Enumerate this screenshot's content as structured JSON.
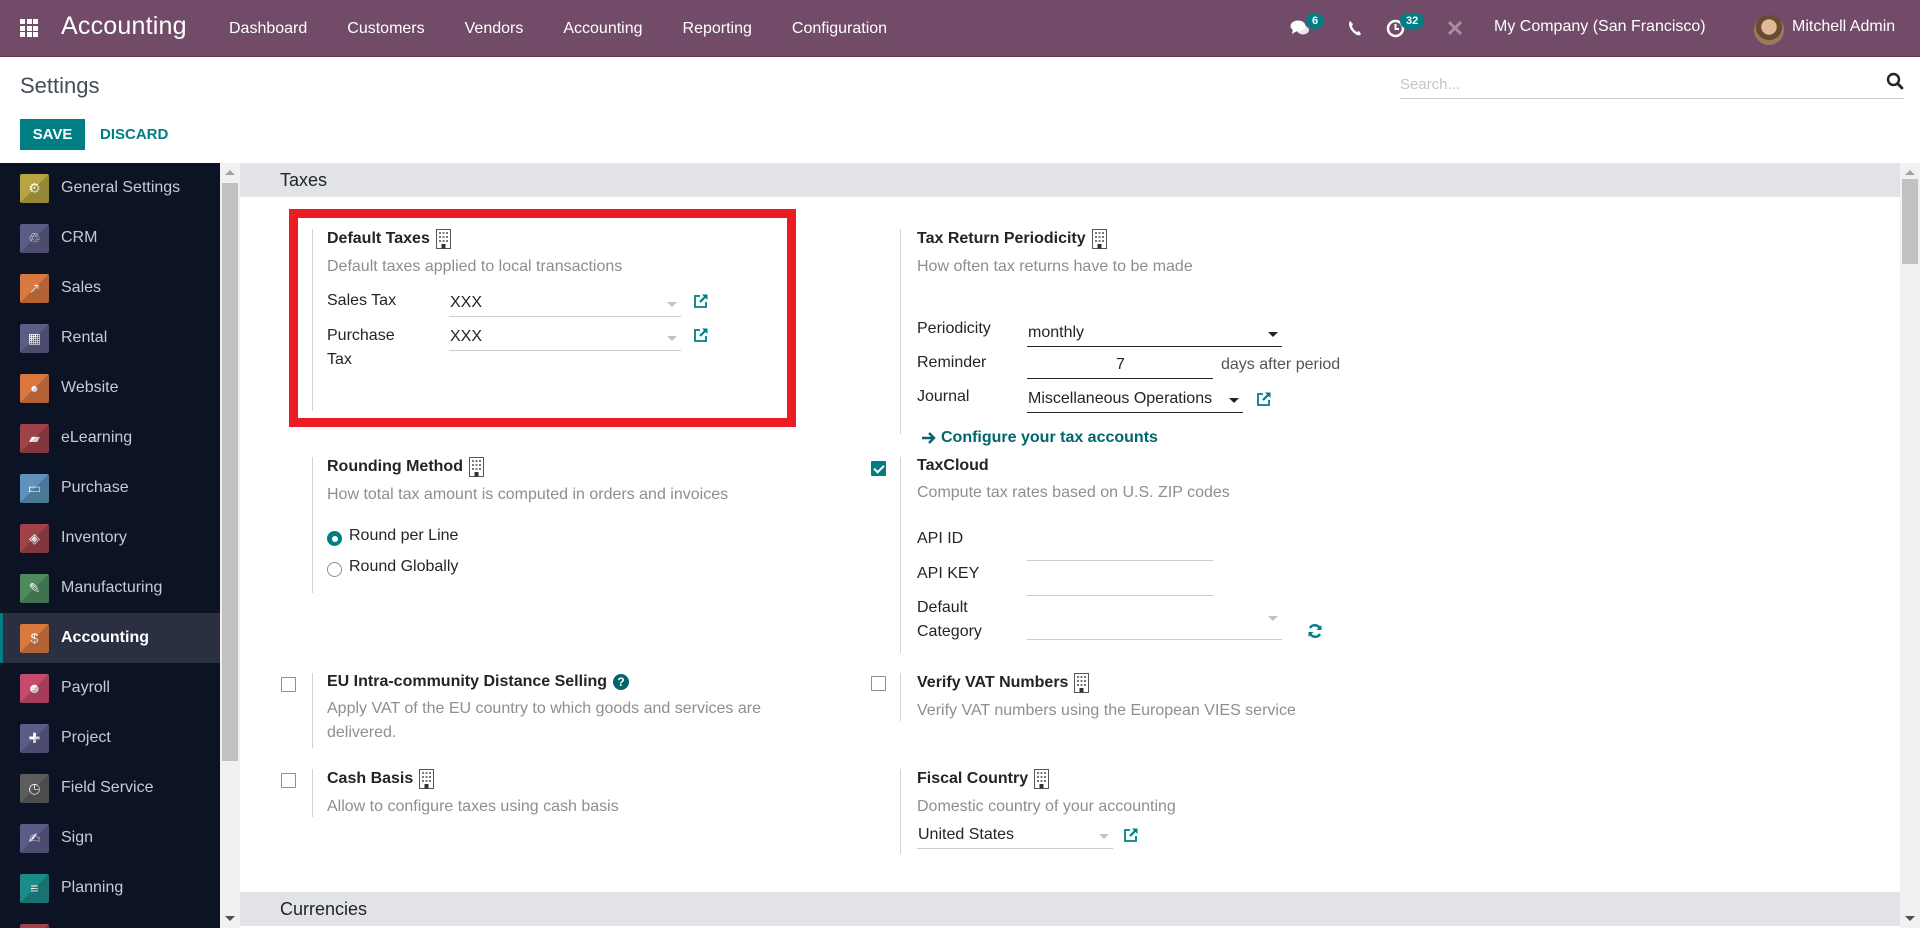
{
  "navbar": {
    "app_name": "Accounting",
    "menu": [
      "Dashboard",
      "Customers",
      "Vendors",
      "Accounting",
      "Reporting",
      "Configuration"
    ],
    "messages_count": "6",
    "activities_count": "32",
    "company": "My Company (San Francisco)",
    "user": "Mitchell Admin",
    "color": "#714B67"
  },
  "control_panel": {
    "title": "Settings",
    "save_label": "SAVE",
    "discard_label": "DISCARD",
    "search_placeholder": "Search..."
  },
  "sidebar": {
    "active": "Accounting",
    "items": [
      {
        "label": "General Settings",
        "icon": "gear-icon",
        "color": "#b6a542"
      },
      {
        "label": "CRM",
        "icon": "handshake-icon",
        "color": "#5b5d87"
      },
      {
        "label": "Sales",
        "icon": "chart-icon",
        "color": "#d9783f"
      },
      {
        "label": "Rental",
        "icon": "calendar-grid-icon",
        "color": "#5b5d87"
      },
      {
        "label": "Website",
        "icon": "globe-icon",
        "color": "#d9783f"
      },
      {
        "label": "eLearning",
        "icon": "presentation-icon",
        "color": "#a1424b"
      },
      {
        "label": "Purchase",
        "icon": "credit-card-icon",
        "color": "#5d93ba"
      },
      {
        "label": "Inventory",
        "icon": "box-icon",
        "color": "#a1424b"
      },
      {
        "label": "Manufacturing",
        "icon": "wrench-icon",
        "color": "#4d8b5f"
      },
      {
        "label": "Accounting",
        "icon": "invoice-dollar-icon",
        "color": "#d9783f"
      },
      {
        "label": "Payroll",
        "icon": "payroll-icon",
        "color": "#c8496e"
      },
      {
        "label": "Project",
        "icon": "puzzle-icon",
        "color": "#5b5d87"
      },
      {
        "label": "Field Service",
        "icon": "field-service-icon",
        "color": "#5c5d5d"
      },
      {
        "label": "Sign",
        "icon": "sign-icon",
        "color": "#5b5d87"
      },
      {
        "label": "Planning",
        "icon": "planning-icon",
        "color": "#1b8c8a"
      },
      {
        "label": "",
        "icon": "app-icon",
        "color": "#a1424b"
      }
    ]
  },
  "sections": {
    "taxes": "Taxes",
    "currencies": "Currencies"
  },
  "settings": {
    "default_taxes": {
      "title": "Default Taxes",
      "desc": "Default taxes applied to local transactions",
      "sales_tax_label": "Sales Tax",
      "sales_tax_value": "XXX",
      "purchase_tax_label_1": "Purchase",
      "purchase_tax_label_2": "Tax",
      "purchase_tax_value": "XXX"
    },
    "tax_return": {
      "title": "Tax Return Periodicity",
      "desc": "How often tax returns have to be made",
      "periodicity_label": "Periodicity",
      "periodicity_value": "monthly",
      "reminder_label": "Reminder",
      "reminder_value": "7",
      "reminder_suffix": "days after period",
      "journal_label": "Journal",
      "journal_value": "Miscellaneous Operations",
      "config_link": "Configure your tax accounts"
    },
    "rounding": {
      "title": "Rounding Method",
      "desc": "How total tax amount is computed in orders and invoices",
      "options": [
        "Round per Line",
        "Round Globally"
      ],
      "selected": "Round per Line"
    },
    "taxcloud": {
      "title": "TaxCloud",
      "checked": true,
      "desc": "Compute tax rates based on U.S. ZIP codes",
      "api_id_label": "API ID",
      "api_id_value": "",
      "api_key_label": "API KEY",
      "api_key_value": "",
      "category_label_1": "Default",
      "category_label_2": "Category",
      "category_value": ""
    },
    "eu_distance": {
      "title": "EU Intra-community Distance Selling",
      "checked": false,
      "desc_1": "Apply VAT of the EU country to which goods and services are",
      "desc_2": "delivered."
    },
    "verify_vat": {
      "title": "Verify VAT Numbers",
      "checked": false,
      "desc": "Verify VAT numbers using the European VIES service"
    },
    "cash_basis": {
      "title": "Cash Basis",
      "checked": false,
      "desc": "Allow to configure taxes using cash basis"
    },
    "fiscal_country": {
      "title": "Fiscal Country",
      "desc": "Domestic country of your accounting",
      "value": "United States"
    }
  },
  "colors": {
    "accent": "#017e84",
    "highlight": "#EC1C24",
    "sidebar_bg": "#0B1325"
  }
}
